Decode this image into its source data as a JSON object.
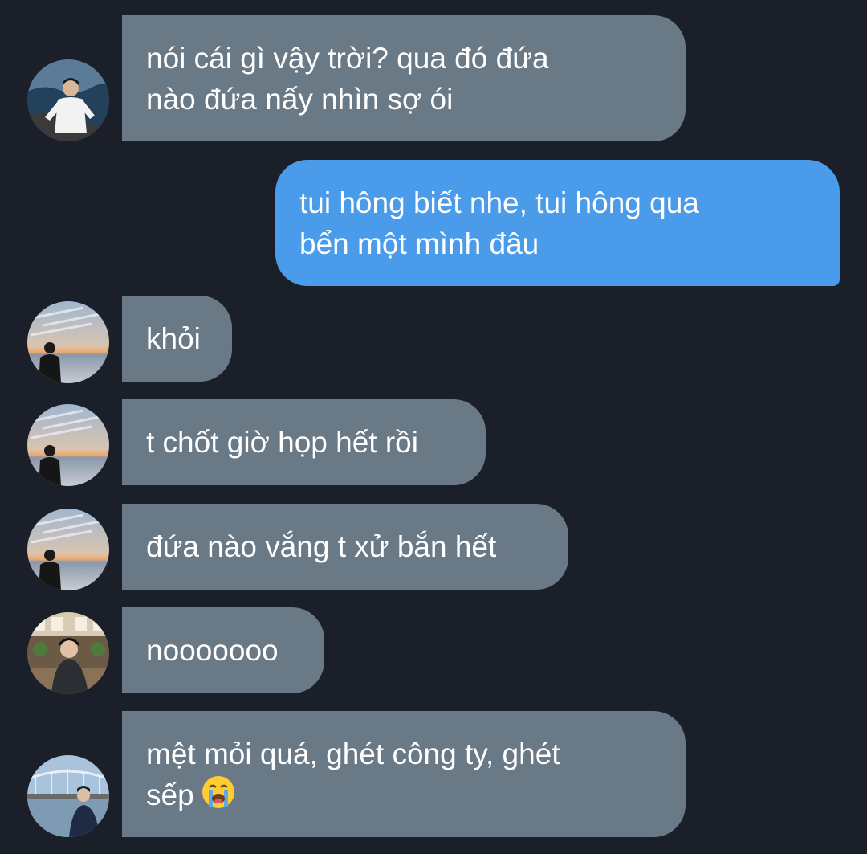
{
  "messages": [
    {
      "id": "m1",
      "direction": "incoming",
      "lines": [
        "nói cái gì vậy trời? qua đó đứa",
        "nào đứa nấy nhìn sợ ói"
      ],
      "avatar": "avatar-boy-rocks"
    },
    {
      "id": "m2",
      "direction": "outgoing",
      "lines": [
        "tui hông biết nhe, tui hông qua",
        "bển một mình đâu"
      ]
    },
    {
      "id": "m3",
      "direction": "incoming",
      "lines": [
        "khỏi"
      ],
      "avatar": "avatar-sunset"
    },
    {
      "id": "m4",
      "direction": "incoming",
      "lines": [
        "t chốt giờ họp hết rồi"
      ],
      "avatar": "avatar-sunset"
    },
    {
      "id": "m5",
      "direction": "incoming",
      "lines": [
        "đứa nào vắng t xử bắn hết"
      ],
      "avatar": "avatar-sunset"
    },
    {
      "id": "m6",
      "direction": "incoming",
      "lines": [
        "nooooooo"
      ],
      "avatar": "avatar-cafe"
    },
    {
      "id": "m7",
      "direction": "incoming",
      "lines": [
        "mệt mỏi quá, ghét công ty, ghét",
        "sếp"
      ],
      "avatar": "avatar-bridge",
      "emoji": "loudly-crying-face-icon"
    }
  ],
  "colors": {
    "background": "#1a1f29",
    "incoming_bubble": "#6a7986",
    "outgoing_bubble": "#4a9ceb",
    "text": "#ffffff"
  }
}
